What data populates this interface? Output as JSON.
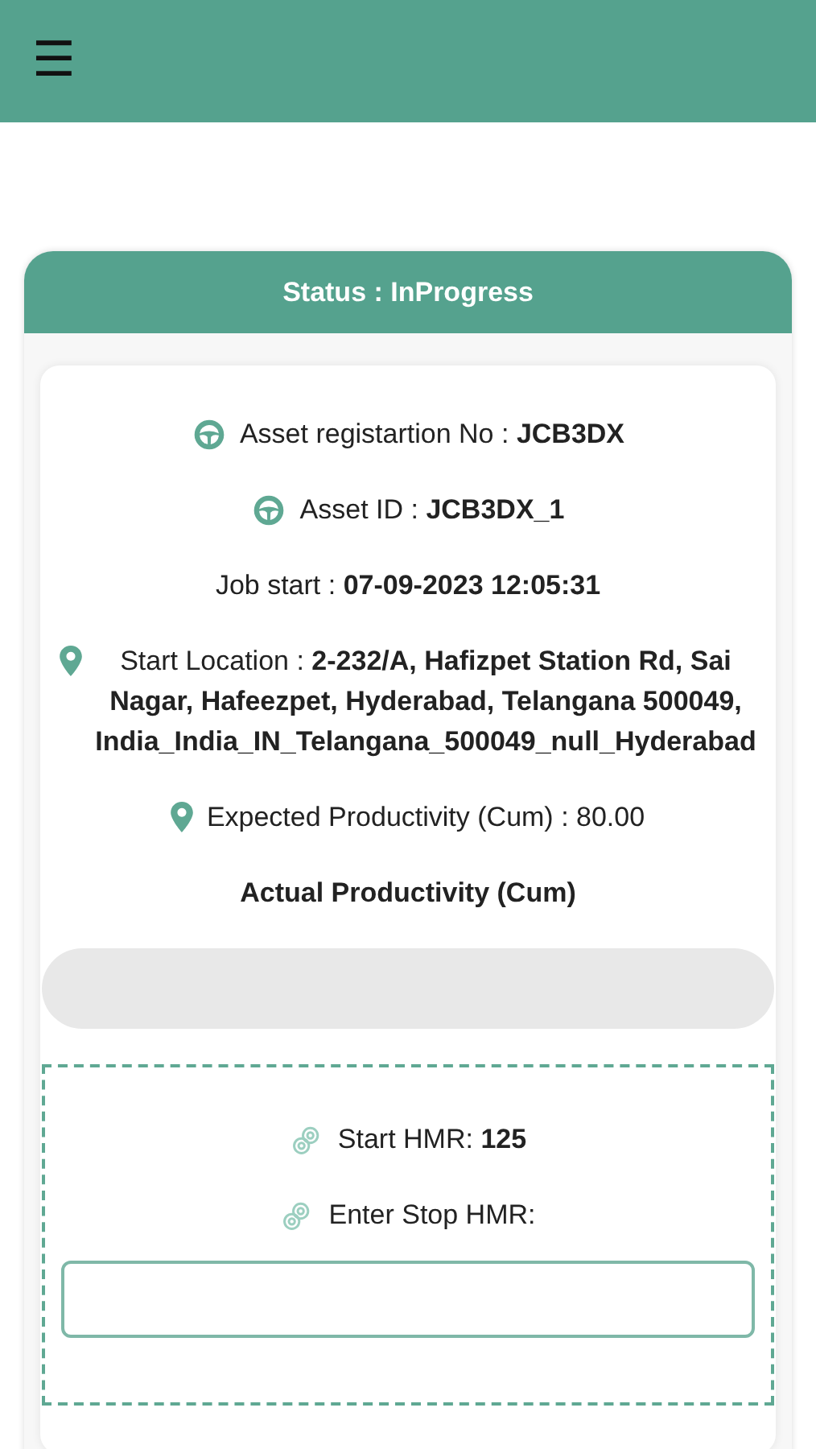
{
  "header": {
    "menu_icon": "☰"
  },
  "status": {
    "title": "Status : InProgress"
  },
  "details": [
    {
      "kind": "asset",
      "text": "Asset registartion No : **JCB3DX**"
    },
    {
      "kind": "asset",
      "text": "Asset ID : **JCB3DX_1**"
    },
    {
      "kind": "time",
      "text": "Job start : **07-09-2023 12:05:31**"
    },
    {
      "kind": "location",
      "text": "Start Location : **2-232/A, Hafizpet Station Rd, Sai Nagar, Hafeezpet, Hyderabad, Telangana 500049, India_India_IN_Telangana_500049_null_Hyderabad**"
    },
    {
      "kind": "location",
      "text": "Expected Productivity (Cum) : 80.00"
    }
  ],
  "actual_productivity": {
    "label": "Actual Productivity (Cum)",
    "disabled": true
  },
  "hmr": {
    "start": "Start HMR: **125**",
    "stop_label": "Enter Stop HMR:"
  }
}
